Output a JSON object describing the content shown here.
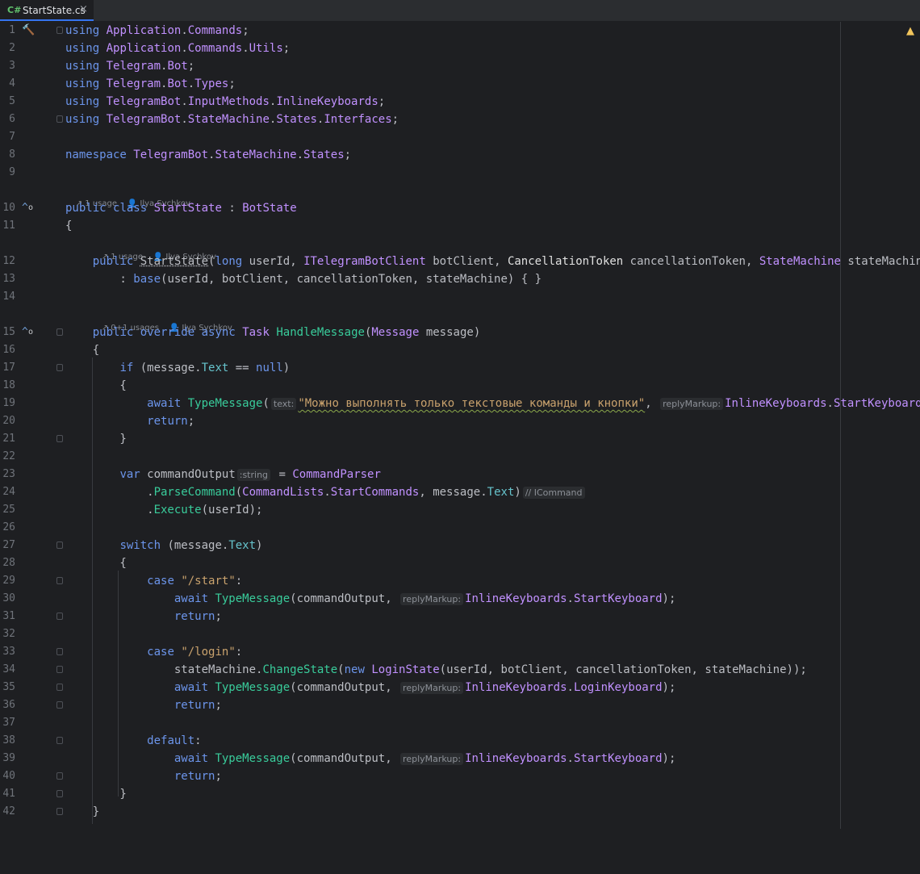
{
  "tab": {
    "lang": "C#",
    "filename": "StartState.cs",
    "close": "×"
  },
  "hints": {
    "class": {
      "usages": "1 usage",
      "author": "Ilya Sychkov"
    },
    "ctor": {
      "usages": "1 usage",
      "author": "Ilya Sychkov"
    },
    "method": {
      "usages": "0+1 usages",
      "author": "Ilya Sychkov"
    }
  },
  "inlay": {
    "text": "text:",
    "replyMarkup": "replyMarkup:",
    "string": ":string",
    "icommand": "// ICommand"
  },
  "lines": [
    {
      "n": "1"
    },
    {
      "n": "2"
    },
    {
      "n": "3"
    },
    {
      "n": "4"
    },
    {
      "n": "5"
    },
    {
      "n": "6"
    },
    {
      "n": "7"
    },
    {
      "n": "8"
    },
    {
      "n": "9"
    },
    {
      "n": "10"
    },
    {
      "n": "11"
    },
    {
      "n": "12"
    },
    {
      "n": "13"
    },
    {
      "n": "14"
    },
    {
      "n": "15"
    },
    {
      "n": "16"
    },
    {
      "n": "17"
    },
    {
      "n": "18"
    },
    {
      "n": "19"
    },
    {
      "n": "20"
    },
    {
      "n": "21"
    },
    {
      "n": "22"
    },
    {
      "n": "23"
    },
    {
      "n": "24"
    },
    {
      "n": "25"
    },
    {
      "n": "26"
    },
    {
      "n": "27"
    },
    {
      "n": "28"
    },
    {
      "n": "29"
    },
    {
      "n": "30"
    },
    {
      "n": "31"
    },
    {
      "n": "32"
    },
    {
      "n": "33"
    },
    {
      "n": "34"
    },
    {
      "n": "35"
    },
    {
      "n": "36"
    },
    {
      "n": "37"
    },
    {
      "n": "38"
    },
    {
      "n": "39"
    },
    {
      "n": "40"
    },
    {
      "n": "41"
    },
    {
      "n": "42"
    }
  ],
  "code": {
    "l1": [
      "using",
      "Application",
      "Commands"
    ],
    "l2": [
      "using",
      "Application",
      "Commands",
      "Utils"
    ],
    "l3": [
      "using",
      "Telegram",
      "Bot"
    ],
    "l4": [
      "using",
      "Telegram",
      "Bot",
      "Types"
    ],
    "l5": [
      "using",
      "TelegramBot",
      "InputMethods",
      "InlineKeyboards"
    ],
    "l6": [
      "using",
      "TelegramBot",
      "StateMachine",
      "States",
      "Interfaces"
    ],
    "l8": [
      "namespace",
      "TelegramBot",
      "StateMachine",
      "States"
    ],
    "l10": [
      "public",
      "class",
      "StartState",
      "BotState"
    ],
    "l12": [
      "public",
      "StartState",
      "long",
      "userId",
      "ITelegramBotClient",
      "botClient",
      "CancellationToken",
      "cancellationToken",
      "StateMachine",
      "stateMachine"
    ],
    "l13": [
      "base",
      "userId",
      "botClient",
      "cancellationToken",
      "stateMachine"
    ],
    "l15": [
      "public",
      "override",
      "async",
      "Task",
      "HandleMessage",
      "Message",
      "message"
    ],
    "l17": [
      "if",
      "message",
      "Text",
      "null"
    ],
    "l19": [
      "await",
      "TypeMessage",
      "\"Можно выполнять только текстовые команды и кнопки\"",
      "InlineKeyboards",
      "StartKeyboard"
    ],
    "l20": [
      "return"
    ],
    "l23": [
      "var",
      "commandOutput",
      "CommandParser"
    ],
    "l24": [
      "ParseCommand",
      "CommandLists",
      "StartCommands",
      "message",
      "Text"
    ],
    "l25": [
      "Execute",
      "userId"
    ],
    "l27": [
      "switch",
      "message",
      "Text"
    ],
    "l29": [
      "case",
      "\"/start\""
    ],
    "l30": [
      "await",
      "TypeMessage",
      "commandOutput",
      "InlineKeyboards",
      "StartKeyboard"
    ],
    "l31": [
      "return"
    ],
    "l33": [
      "case",
      "\"/login\""
    ],
    "l34": [
      "stateMachine",
      "ChangeState",
      "new",
      "LoginState",
      "userId",
      "botClient",
      "cancellationToken",
      "stateMachine"
    ],
    "l35": [
      "await",
      "TypeMessage",
      "commandOutput",
      "InlineKeyboards",
      "LoginKeyboard"
    ],
    "l36": [
      "return"
    ],
    "l38": [
      "default"
    ],
    "l39": [
      "await",
      "TypeMessage",
      "commandOutput",
      "InlineKeyboards",
      "StartKeyboard"
    ],
    "l40": [
      "return"
    ]
  }
}
